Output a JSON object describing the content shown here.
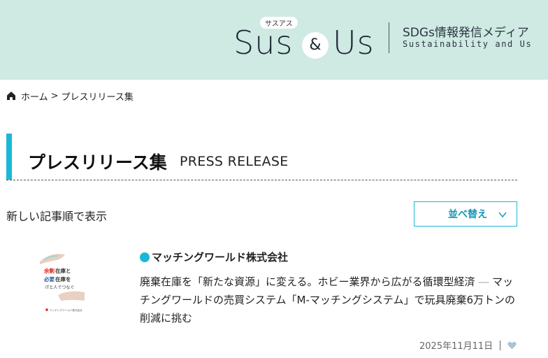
{
  "header": {
    "logo_kana": "サスアス",
    "logo_sus": "Sus",
    "logo_amp": "&",
    "logo_us": "Us",
    "tagline": "SDGs情報発信メディア",
    "tagline_en": "Sustainability and Us",
    "background_color": "#cfe9e3"
  },
  "breadcrumb": {
    "icon": "home-icon",
    "home_label": "ホーム",
    "separator": ">",
    "current_label": "プレスリリース集"
  },
  "page_title": {
    "ja": "プレスリリース集",
    "en": "PRESS RELEASE",
    "accent_color": "#1bb8d6"
  },
  "sort": {
    "label": "新しい記事順で表示",
    "button_label": "並べ替え",
    "button_icon": "chevron-down-icon"
  },
  "articles": [
    {
      "company": "マッチングワールド株式会社",
      "title": "廃棄在庫を「新たな資源」に変える。ホビー業界から広がる循環型経済",
      "title_dash": "―",
      "subtitle": "マッチングワールドの売買システム「M-マッチングシステム」で玩具廃棄6万トンの削減に挑む",
      "date": "2025年11月11日",
      "like_icon": "heart-icon",
      "thumbnail": {
        "line1_red": "余剰",
        "line1_rest": "在庫と",
        "line2_red": "必要",
        "line2_rest": "在庫を",
        "line3": "ITと人でつなぐ",
        "brand": "マッチングワールド株式会社"
      }
    }
  ]
}
